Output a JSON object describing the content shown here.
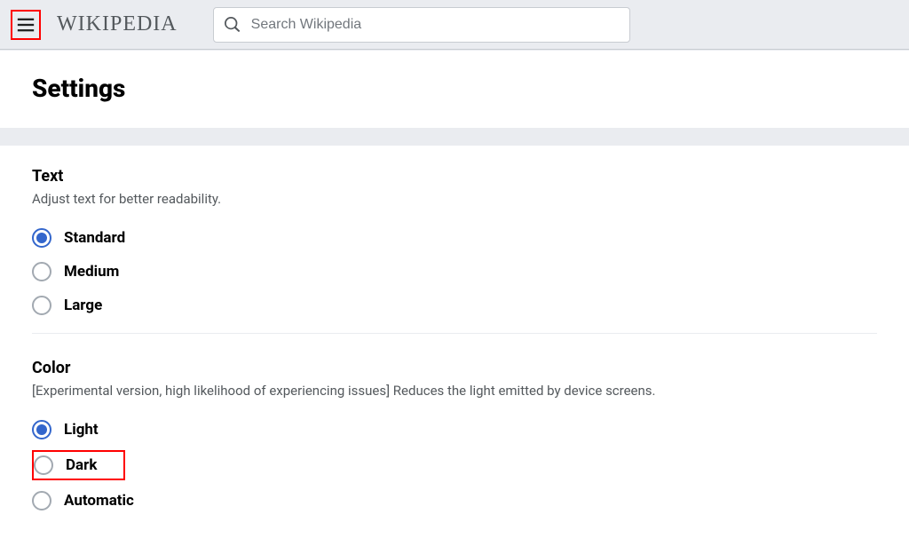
{
  "header": {
    "logo_text": "WIKIPEDIA",
    "search_placeholder": "Search Wikipedia"
  },
  "page": {
    "title": "Settings"
  },
  "sections": {
    "text": {
      "title": "Text",
      "description": "Adjust text for better readability.",
      "options": {
        "standard": "Standard",
        "medium": "Medium",
        "large": "Large"
      }
    },
    "color": {
      "title": "Color",
      "description": "[Experimental version, high likelihood of experiencing issues] Reduces the light emitted by device screens.",
      "options": {
        "light": "Light",
        "dark": "Dark",
        "automatic": "Automatic"
      }
    }
  }
}
